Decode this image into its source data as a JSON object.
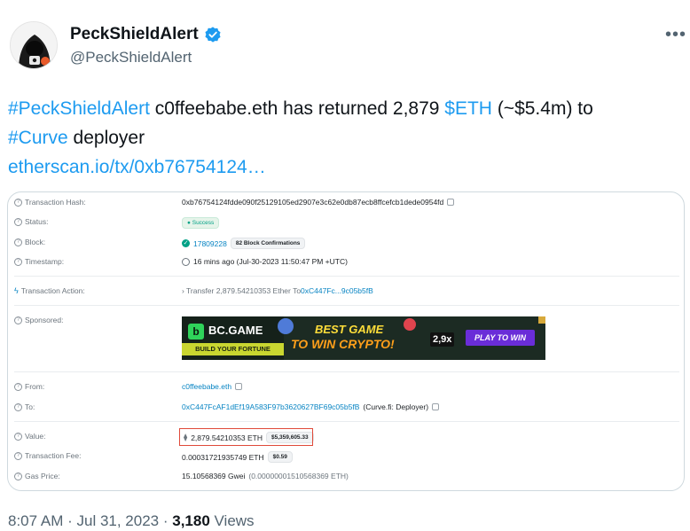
{
  "author": {
    "display_name": "PeckShieldAlert",
    "handle": "@PeckShieldAlert",
    "verified": true,
    "avatar_icon": "hooded-hacker-avatar"
  },
  "tweet": {
    "tag_peckshield": "#PeckShieldAlert",
    "text_part1": " c0ffeebabe.eth has returned 2,879 ",
    "cashtag_eth": "$ETH",
    "text_part2": " (~$5.4m) to",
    "tag_curve": "#Curve",
    "text_part3": " deployer",
    "link": "etherscan.io/tx/0xb76754124…"
  },
  "etherscan": {
    "rows": {
      "tx_hash": {
        "label": "Transaction Hash:",
        "value": "0xb76754124fdde090f25129105ed2907e3c62e0db87ecb8ffcefcb1dede0954fd"
      },
      "status": {
        "label": "Status:",
        "value": "Success"
      },
      "block": {
        "label": "Block:",
        "value": "17809228",
        "confirmations": "82 Block Confirmations"
      },
      "timestamp": {
        "label": "Timestamp:",
        "value": "16 mins ago (Jul-30-2023 11:50:47 PM +UTC)"
      },
      "action": {
        "label": "Transaction Action:",
        "prefix": "› Transfer 2,879.54210353 Ether To ",
        "to": "0xC447Fc...9c05b5fB"
      },
      "sponsored": {
        "label": "Sponsored:"
      },
      "from": {
        "label": "From:",
        "value": "c0ffeebabe.eth"
      },
      "to": {
        "label": "To:",
        "value": "0xC447FcAF1dEf19A583F97b3620627BF69c05b5fB",
        "note": "(Curve.fi: Deployer)"
      },
      "value": {
        "label": "Value:",
        "value": "2,879.54210353 ETH",
        "usd": "$5,359,605.33"
      },
      "fee": {
        "label": "Transaction Fee:",
        "value": "0.00031721935749 ETH",
        "usd": "$0.59"
      },
      "gas": {
        "label": "Gas Price:",
        "value": "15.10568369 Gwei",
        "eth": "(0.00000001510568369 ETH)"
      }
    },
    "ad": {
      "brand": "BC.GAME",
      "tagline": "BUILD YOUR FORTUNE",
      "headline_1": "BEST GAME",
      "headline_2": "TO WIN CRYPTO!",
      "multiplier": "2,9x",
      "cta": "PLAY TO WIN"
    }
  },
  "meta": {
    "time": "8:07 AM",
    "sep1": " · ",
    "date": "Jul 31, 2023",
    "sep2": " · ",
    "views_count": "3,180",
    "views_label": " Views"
  },
  "colors": {
    "link_blue": "#1d9bf0",
    "verified_blue": "#1d9bf0",
    "highlight_red": "#e04a3a",
    "etherscan_link": "#0784c3"
  }
}
